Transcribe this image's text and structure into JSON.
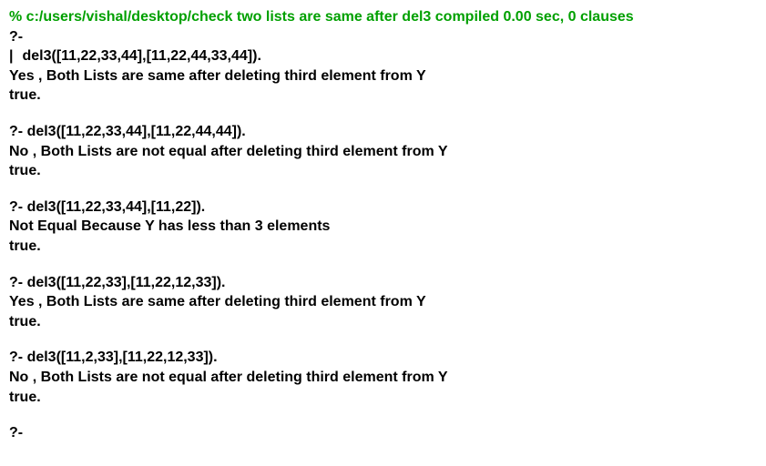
{
  "compile": "% c:/users/vishal/desktop/check two lists are same after del3 compiled 0.00 sec, 0 clauses",
  "prompt": "?-",
  "cursor": "|",
  "queries": [
    {
      "query": "del3([11,22,33,44],[11,22,44,33,44]).",
      "output": "Yes , Both Lists are same after deleting third element from Y",
      "result": "true."
    },
    {
      "query": "del3([11,22,33,44],[11,22,44,44]).",
      "output": "No , Both Lists are not equal after deleting third element from Y",
      "result": "true."
    },
    {
      "query": "del3([11,22,33,44],[11,22]).",
      "output": "Not Equal Because Y has less than 3 elements",
      "result": "true."
    },
    {
      "query": "del3([11,22,33],[11,22,12,33]).",
      "output": "Yes , Both Lists are same after deleting third element from Y",
      "result": "true."
    },
    {
      "query": "del3([11,2,33],[11,22,12,33]).",
      "output": "No , Both Lists are not equal after deleting third element from Y",
      "result": "true."
    }
  ]
}
